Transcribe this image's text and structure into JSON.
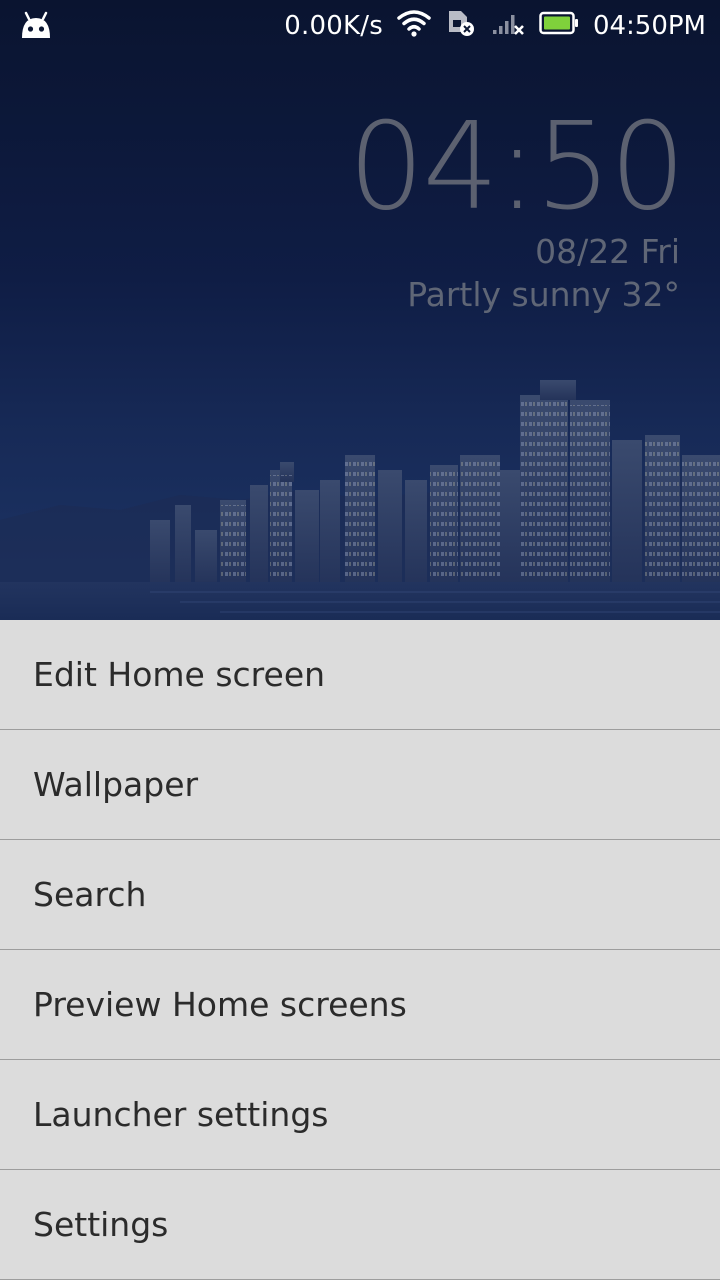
{
  "status_bar": {
    "app_icon": "android-robot-icon",
    "net_speed": "0.00K/s",
    "icons": [
      "wifi-icon",
      "sim-card-x-icon",
      "signal-x-icon",
      "battery-icon"
    ],
    "time": "04:50PM",
    "battery_color": "#7fd13b"
  },
  "clock_widget": {
    "time": "04:50",
    "date": "08/22 Fri",
    "weather": "Partly sunny  32°"
  },
  "menu": {
    "items": [
      {
        "label": "Edit Home screen"
      },
      {
        "label": "Wallpaper"
      },
      {
        "label": "Search"
      },
      {
        "label": "Preview Home screens"
      },
      {
        "label": "Launcher settings"
      },
      {
        "label": "Settings"
      }
    ]
  }
}
